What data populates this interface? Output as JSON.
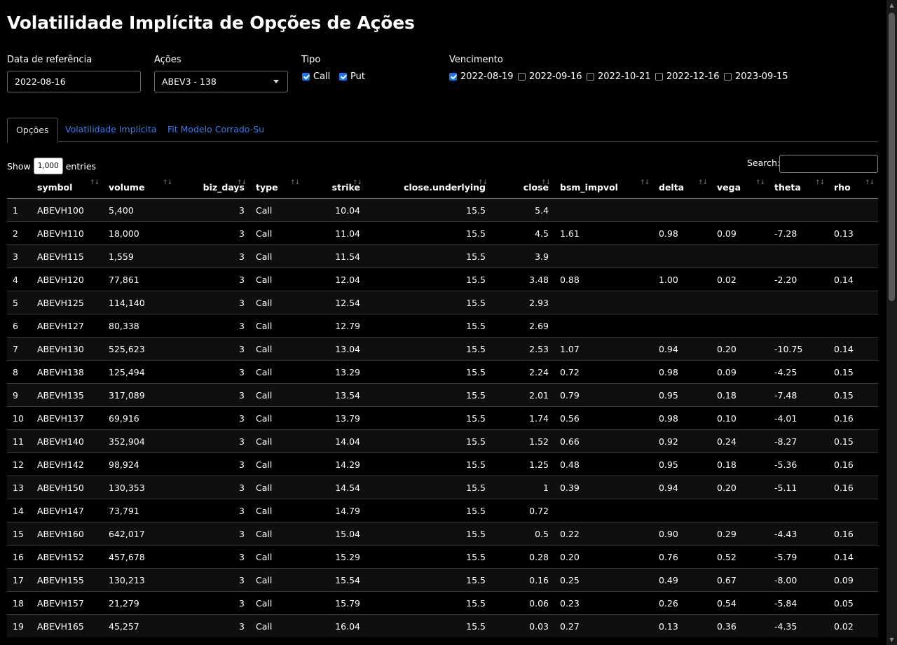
{
  "title": "Volatilidade Implícita de Opções de Ações",
  "filters": {
    "date_label": "Data de referência",
    "date_value": "2022-08-16",
    "stock_label": "Ações",
    "stock_value": "ABEV3 - 138",
    "type_label": "Tipo",
    "types": [
      {
        "label": "Call",
        "checked": true
      },
      {
        "label": "Put",
        "checked": true
      }
    ],
    "expiry_label": "Vencimento",
    "expiries": [
      {
        "label": "2022-08-19",
        "checked": true
      },
      {
        "label": "2022-09-16",
        "checked": false
      },
      {
        "label": "2022-10-21",
        "checked": false
      },
      {
        "label": "2022-12-16",
        "checked": false
      },
      {
        "label": "2023-09-15",
        "checked": false
      }
    ]
  },
  "tabs": [
    {
      "label": "Opções",
      "active": true
    },
    {
      "label": "Volatilidade Implícita",
      "active": false
    },
    {
      "label": "Fit Modelo Corrado-Su",
      "active": false
    }
  ],
  "table_controls": {
    "show_label": "Show",
    "length_value": "1,000",
    "entries_label": "entries",
    "search_label": "Search:"
  },
  "columns": [
    "",
    "symbol",
    "volume",
    "biz_days",
    "type",
    "strike",
    "close.underlying",
    "close",
    "bsm_impvol",
    "delta",
    "vega",
    "theta",
    "rho"
  ],
  "rows": [
    [
      "1",
      "ABEVH100",
      "5,400",
      "3",
      "Call",
      "10.04",
      "15.5",
      "5.4",
      "",
      "",
      "",
      "",
      ""
    ],
    [
      "2",
      "ABEVH110",
      "18,000",
      "3",
      "Call",
      "11.04",
      "15.5",
      "4.5",
      "1.61",
      "0.98",
      "0.09",
      "-7.28",
      "0.13"
    ],
    [
      "3",
      "ABEVH115",
      "1,559",
      "3",
      "Call",
      "11.54",
      "15.5",
      "3.9",
      "",
      "",
      "",
      "",
      ""
    ],
    [
      "4",
      "ABEVH120",
      "77,861",
      "3",
      "Call",
      "12.04",
      "15.5",
      "3.48",
      "0.88",
      "1.00",
      "0.02",
      "-2.20",
      "0.14"
    ],
    [
      "5",
      "ABEVH125",
      "114,140",
      "3",
      "Call",
      "12.54",
      "15.5",
      "2.93",
      "",
      "",
      "",
      "",
      ""
    ],
    [
      "6",
      "ABEVH127",
      "80,338",
      "3",
      "Call",
      "12.79",
      "15.5",
      "2.69",
      "",
      "",
      "",
      "",
      ""
    ],
    [
      "7",
      "ABEVH130",
      "525,623",
      "3",
      "Call",
      "13.04",
      "15.5",
      "2.53",
      "1.07",
      "0.94",
      "0.20",
      "-10.75",
      "0.14"
    ],
    [
      "8",
      "ABEVH138",
      "125,494",
      "3",
      "Call",
      "13.29",
      "15.5",
      "2.24",
      "0.72",
      "0.98",
      "0.09",
      "-4.25",
      "0.15"
    ],
    [
      "9",
      "ABEVH135",
      "317,089",
      "3",
      "Call",
      "13.54",
      "15.5",
      "2.01",
      "0.79",
      "0.95",
      "0.18",
      "-7.48",
      "0.15"
    ],
    [
      "10",
      "ABEVH137",
      "69,916",
      "3",
      "Call",
      "13.79",
      "15.5",
      "1.74",
      "0.56",
      "0.98",
      "0.10",
      "-4.01",
      "0.16"
    ],
    [
      "11",
      "ABEVH140",
      "352,904",
      "3",
      "Call",
      "14.04",
      "15.5",
      "1.52",
      "0.66",
      "0.92",
      "0.24",
      "-8.27",
      "0.15"
    ],
    [
      "12",
      "ABEVH142",
      "98,924",
      "3",
      "Call",
      "14.29",
      "15.5",
      "1.25",
      "0.48",
      "0.95",
      "0.18",
      "-5.36",
      "0.16"
    ],
    [
      "13",
      "ABEVH150",
      "130,353",
      "3",
      "Call",
      "14.54",
      "15.5",
      "1",
      "0.39",
      "0.94",
      "0.20",
      "-5.11",
      "0.16"
    ],
    [
      "14",
      "ABEVH147",
      "73,791",
      "3",
      "Call",
      "14.79",
      "15.5",
      "0.72",
      "",
      "",
      "",
      "",
      ""
    ],
    [
      "15",
      "ABEVH160",
      "642,017",
      "3",
      "Call",
      "15.04",
      "15.5",
      "0.5",
      "0.22",
      "0.90",
      "0.29",
      "-4.43",
      "0.16"
    ],
    [
      "16",
      "ABEVH152",
      "457,678",
      "3",
      "Call",
      "15.29",
      "15.5",
      "0.28",
      "0.20",
      "0.76",
      "0.52",
      "-5.79",
      "0.14"
    ],
    [
      "17",
      "ABEVH155",
      "130,213",
      "3",
      "Call",
      "15.54",
      "15.5",
      "0.16",
      "0.25",
      "0.49",
      "0.67",
      "-8.00",
      "0.09"
    ],
    [
      "18",
      "ABEVH157",
      "21,279",
      "3",
      "Call",
      "15.79",
      "15.5",
      "0.06",
      "0.23",
      "0.26",
      "0.54",
      "-5.84",
      "0.05"
    ],
    [
      "19",
      "ABEVH165",
      "45,257",
      "3",
      "Call",
      "16.04",
      "15.5",
      "0.03",
      "0.27",
      "0.13",
      "0.36",
      "-4.35",
      "0.02"
    ]
  ],
  "colors": {
    "link": "#3d7de0",
    "check": "#1a73e8",
    "background": "#000000"
  }
}
